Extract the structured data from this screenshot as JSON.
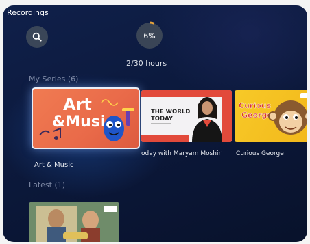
{
  "header": {
    "title": "Recordings"
  },
  "storage": {
    "percent_label": "6%",
    "percent_used": 0.06,
    "hours_label": "2/30 hours"
  },
  "sections": {
    "series_title": "My Series (6)",
    "latest_title": "Latest (1)"
  },
  "series": [
    {
      "label": "Art & Music",
      "art_line1": "Art",
      "art_line2": "&Music"
    },
    {
      "label": "oday with Maryam Moshiri",
      "art_line1": "THE WORLD",
      "art_line2": "TODAY"
    },
    {
      "label": "Curious George",
      "art_line1": "Curious",
      "art_line2": "George"
    }
  ],
  "colors": {
    "accent_storage": "#e8a43a",
    "focus_border": "#e9eef8",
    "section_text": "#7f8aa6"
  },
  "icons": {
    "search": "search-icon"
  }
}
